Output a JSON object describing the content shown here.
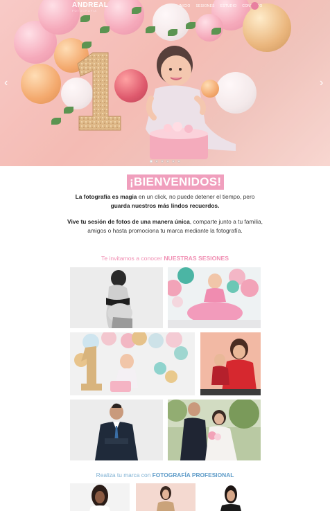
{
  "header": {
    "logo_main": "ANDREAL",
    "logo_sub": "FOTOGRAFIA",
    "nav": [
      "INICIO",
      "SESIONES",
      "ESTUDIO",
      "CONTACTO"
    ]
  },
  "hero": {
    "slide_count": 6,
    "active_slide": 1,
    "prev_arrow": "‹",
    "next_arrow": "›"
  },
  "welcome": {
    "title": "¡BIENVENIDOS!",
    "p1_bold1": "La fotografía es magia",
    "p1_text1": " en un click, no puede detener el tiempo, pero ",
    "p1_bold2": "guarda nuestros más lindos recuerdos.",
    "p2_bold": "Vive tu sesión de fotos de una manera única",
    "p2_text": ", comparte junto a tu familia, amigos o hasta promociona tu marca mediante la fotografía."
  },
  "sessions": {
    "lead": "Te invitamos a conocer ",
    "highlight": "NUESTRAS SESIONES"
  },
  "brand": {
    "lead": "Realiza tu marca con ",
    "highlight": "FOTOGRAFÍA PROFESIONAL"
  },
  "colors": {
    "accent_pink": "#f09fbd",
    "accent_blue": "#5d9bc8"
  }
}
